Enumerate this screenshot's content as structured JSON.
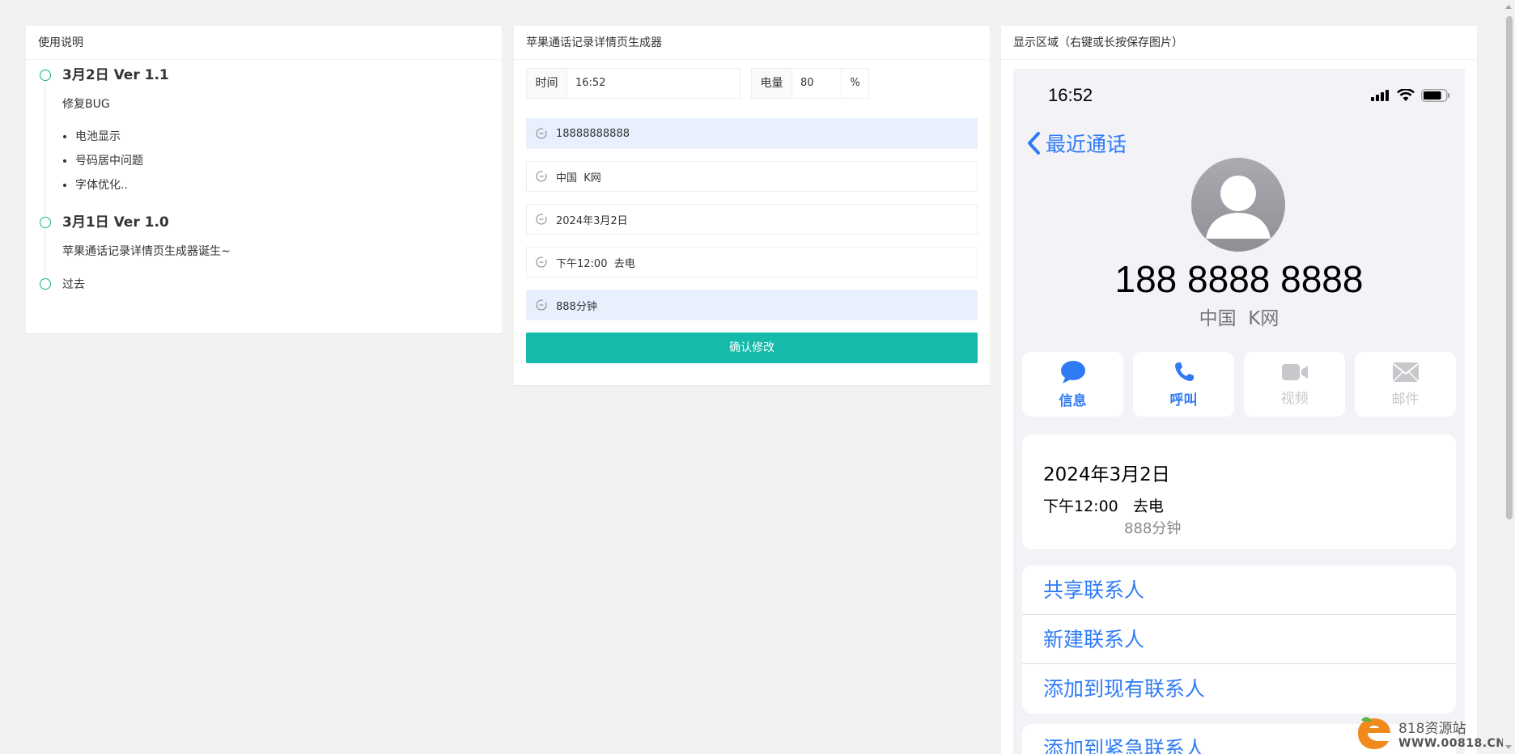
{
  "instructions": {
    "title": "使用说明",
    "versions": [
      {
        "title": "3月2日 Ver 1.1",
        "text": "修复BUG",
        "items": [
          "电池显示",
          "号码居中问题",
          "字体优化.."
        ]
      },
      {
        "title": "3月1日 Ver 1.0",
        "text": "苹果通话记录详情页生成器诞生~"
      }
    ],
    "past": "过去"
  },
  "form": {
    "title": "苹果通话记录详情页生成器",
    "time_label": "时间",
    "time_value": "16:52",
    "battery_label": "电量",
    "battery_value": "80",
    "battery_suffix": "%",
    "phone": "18888888888",
    "region": "中国  K网",
    "date": "2024年3月2日",
    "call_type": "下午12:00  去电",
    "duration": "888分钟",
    "submit_label": "确认修改"
  },
  "display": {
    "title": "显示区域（右键或长按保存图片）",
    "status_time": "16:52",
    "battery_level": 0.8,
    "back_label": "最近通话",
    "number": "188 8888 8888",
    "region": "中国  K网",
    "actions": [
      {
        "label": "信息",
        "icon": "message-icon",
        "state": "active"
      },
      {
        "label": "呼叫",
        "icon": "phone-icon",
        "state": "active"
      },
      {
        "label": "视频",
        "icon": "video-icon",
        "state": "disabled"
      },
      {
        "label": "邮件",
        "icon": "mail-icon",
        "state": "disabled"
      }
    ],
    "call_date": "2024年3月2日",
    "call_info": "下午12:00   去电",
    "call_duration": "888分钟",
    "contact_actions": [
      "共享联系人",
      "新建联系人",
      "添加到现有联系人"
    ],
    "contact_actions2": [
      "添加到紧急联系人"
    ],
    "accent_color": "#2f7bf6"
  },
  "watermark": {
    "name": "818资源站",
    "url": "WWW.00818.CN"
  }
}
